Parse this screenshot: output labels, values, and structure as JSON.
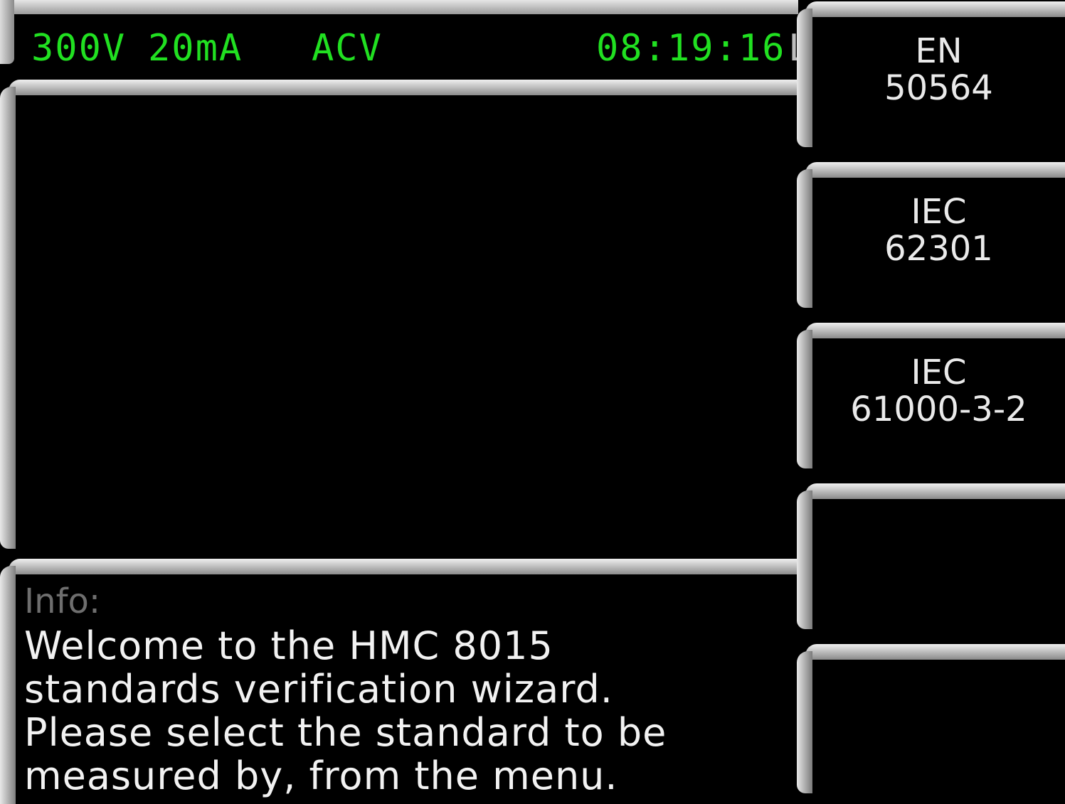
{
  "status": {
    "voltage_range": "300V",
    "current_range": "20mA",
    "mode": "ACV",
    "time": "08:19:16",
    "clipped_indicator": "L",
    "text_color": "#21e021"
  },
  "info": {
    "label": "Info:",
    "message": "Welcome to the HMC 8015\nstandards verification wizard.\nPlease select the standard to be\nmeasured by, from the menu."
  },
  "menu": {
    "items": [
      {
        "label": "EN\n50564"
      },
      {
        "label": "IEC\n62301"
      },
      {
        "label": "IEC\n61000-3-2"
      },
      {
        "label": ""
      },
      {
        "label": ""
      }
    ]
  }
}
